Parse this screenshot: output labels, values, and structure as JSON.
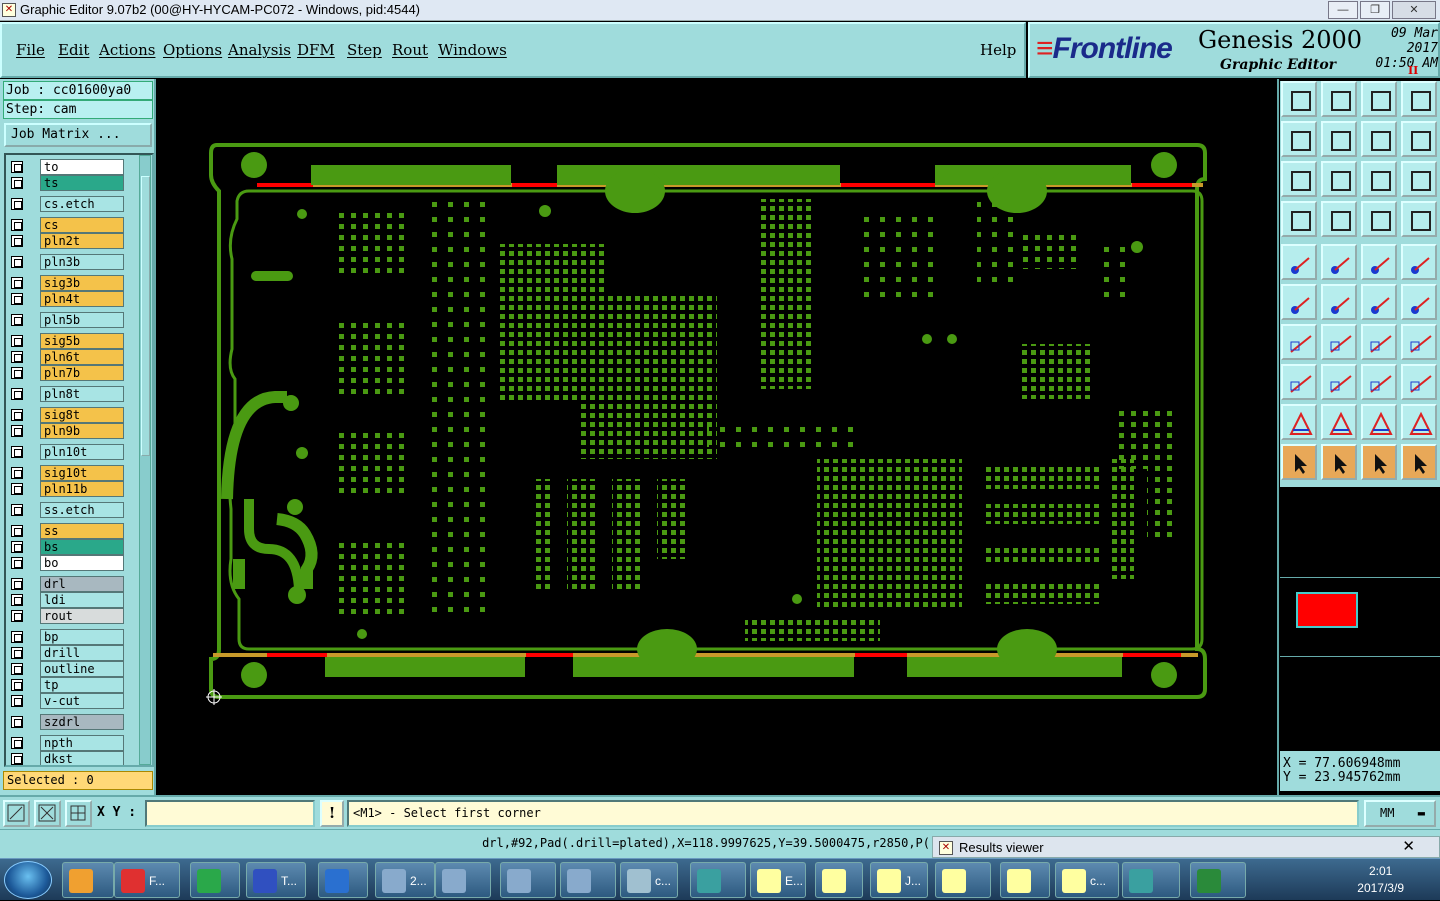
{
  "window": {
    "title": "Graphic Editor 9.07b2 (00@HY-HYCAM-PC072 - Windows, pid:4544)",
    "buttons": [
      "—",
      "❐",
      "✕"
    ]
  },
  "menu": [
    "File",
    "Edit",
    "Actions",
    "Options",
    "Analysis",
    "DFM",
    "Step",
    "Rout",
    "Windows"
  ],
  "help": "Help",
  "brand": {
    "logo_text": "Frontline",
    "product": "Genesis 2000",
    "subtitle": "Graphic Editor",
    "date": "09 Mar 2017",
    "time": "01:50 AM",
    "pause": "II"
  },
  "job": {
    "job_label": "Job : cc01600ya0",
    "step_label": "Step: cam",
    "matrix_button": "Job Matrix ..."
  },
  "layers": [
    {
      "name": "to",
      "color": "#ffffff"
    },
    {
      "name": "ts",
      "color": "#2aa88a"
    },
    {
      "name": "cs.etch",
      "color": "#a8e4e4"
    },
    {
      "name": "cs",
      "color": "#f4c24a"
    },
    {
      "name": "pln2t",
      "color": "#f4c24a"
    },
    {
      "name": "pln3b",
      "color": "#a8e4e4"
    },
    {
      "name": "sig3b",
      "color": "#f4c24a"
    },
    {
      "name": "pln4t",
      "color": "#f4c24a"
    },
    {
      "name": "pln5b",
      "color": "#a8e4e4"
    },
    {
      "name": "sig5b",
      "color": "#f4c24a"
    },
    {
      "name": "pln6t",
      "color": "#f4c24a"
    },
    {
      "name": "pln7b",
      "color": "#f4c24a"
    },
    {
      "name": "pln8t",
      "color": "#a8e4e4"
    },
    {
      "name": "sig8t",
      "color": "#f4c24a"
    },
    {
      "name": "pln9b",
      "color": "#f4c24a"
    },
    {
      "name": "pln10t",
      "color": "#a8e4e4"
    },
    {
      "name": "sig10t",
      "color": "#f4c24a"
    },
    {
      "name": "pln11b",
      "color": "#f4c24a"
    },
    {
      "name": "ss.etch",
      "color": "#a8e4e4"
    },
    {
      "name": "ss",
      "color": "#f4c24a"
    },
    {
      "name": "bs",
      "color": "#2aa88a"
    },
    {
      "name": "bo",
      "color": "#ffffff"
    },
    {
      "name": "drl",
      "color": "#a8b8c0"
    },
    {
      "name": "ldi",
      "color": "#a8e4e4"
    },
    {
      "name": "rout",
      "color": "#d8dcdc"
    },
    {
      "name": "bp",
      "color": "#a8e4e4"
    },
    {
      "name": "drill",
      "color": "#a8e4e4"
    },
    {
      "name": "outline",
      "color": "#a8e4e4"
    },
    {
      "name": "tp",
      "color": "#a8e4e4"
    },
    {
      "name": "v-cut",
      "color": "#a8e4e4"
    },
    {
      "name": "szdrl",
      "color": "#a8b8c0"
    },
    {
      "name": "npth",
      "color": "#a8e4e4"
    },
    {
      "name": "dkst",
      "color": "#a8e4e4"
    }
  ],
  "selected": "Selected : 0",
  "coords": {
    "x": "X = 77.606948mm",
    "y": "Y = 23.945762mm"
  },
  "bottom": {
    "xy_label": "X Y :",
    "xy_value": "",
    "excl": "!",
    "prompt": "<M1> - Select first corner",
    "units": "MM"
  },
  "status": "drl,#92,Pad(.drill=plated),X=118.9997625,Y=39.5000475,r2850,P(",
  "results_viewer": {
    "title": "Results viewer",
    "close": "✕"
  },
  "colors": {
    "board": "#4a9a12",
    "copper_outline": "#c89a2a",
    "vcut": "#ff0000"
  },
  "taskbar": {
    "items": [
      {
        "label": "",
        "color": "#f0a030"
      },
      {
        "label": "F...",
        "color": "#e03030"
      },
      {
        "label": "",
        "color": "#2aa84a"
      },
      {
        "label": "T...",
        "color": "#3050c0"
      },
      {
        "label": "",
        "color": "#2a70d0"
      },
      {
        "label": "2...",
        "color": "#88aacc"
      },
      {
        "label": "",
        "color": "#88aacc"
      },
      {
        "label": "",
        "color": "#88aacc"
      },
      {
        "label": "",
        "color": "#88aacc"
      },
      {
        "label": "c...",
        "color": "#a0c0d0"
      },
      {
        "label": "",
        "color": "#3aa0a0"
      },
      {
        "label": "E...",
        "color": "#ffffa0"
      },
      {
        "label": "",
        "color": "#ffffa0"
      },
      {
        "label": "J...",
        "color": "#ffffa0"
      },
      {
        "label": "",
        "color": "#ffffa0"
      },
      {
        "label": "",
        "color": "#ffffa0"
      },
      {
        "label": "c...",
        "color": "#ffffa0"
      },
      {
        "label": "",
        "color": "#3aa0a0"
      },
      {
        "label": "",
        "color": "#2a8a3a"
      }
    ],
    "clock_time": "2:01",
    "clock_date": "2017/3/9"
  }
}
